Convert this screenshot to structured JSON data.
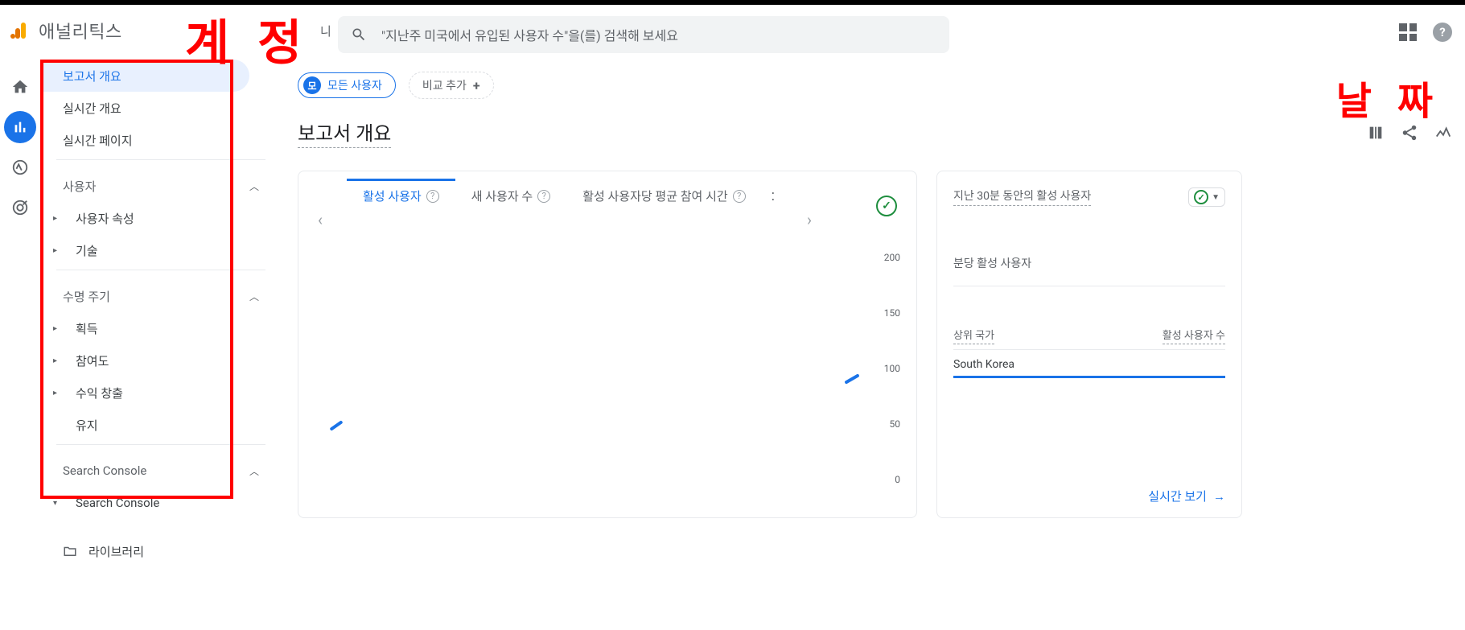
{
  "header": {
    "app_name": "애널리틱스",
    "search_placeholder": "\"지난주 미국에서 유입된 사용자 수\"을(를) 검색해 보세요",
    "fragment": "니"
  },
  "annotations": {
    "account": "계 정",
    "date": "날 짜"
  },
  "sidebar": {
    "items": [
      {
        "label": "보고서 개요",
        "selected": true
      },
      {
        "label": "실시간 개요"
      },
      {
        "label": "실시간 페이지"
      }
    ],
    "section_user": "사용자",
    "user_items": [
      {
        "label": "사용자 속성"
      },
      {
        "label": "기술"
      }
    ],
    "section_lifecycle": "수명 주기",
    "lifecycle_items": [
      {
        "label": "획득"
      },
      {
        "label": "참여도"
      },
      {
        "label": "수익 창출"
      },
      {
        "label": "유지"
      }
    ],
    "section_sc": "Search Console",
    "sc_items": [
      {
        "label": "Search Console"
      }
    ],
    "library": "라이브러리"
  },
  "comparison": {
    "all_users_badge": "모",
    "all_users": "모든 사용자",
    "add_comparison": "비교 추가"
  },
  "page_title": "보고서 개요",
  "metrics": {
    "active_users": "활성 사용자",
    "new_users": "새 사용자 수",
    "avg_engagement": "활성 사용자당 평균 참여 시간",
    "ellipsis": ":"
  },
  "chart_data": {
    "type": "line",
    "y_ticks": [
      "200",
      "150",
      "100",
      "50",
      "0"
    ],
    "ylim": [
      0,
      200
    ],
    "series": [
      {
        "name": "활성 사용자",
        "values": []
      }
    ]
  },
  "realtime_card": {
    "title": "지난 30분 동안의 활성 사용자",
    "per_minute": "분당 활성 사용자",
    "col_country": "상위 국가",
    "col_users": "활성 사용자 수",
    "row_country": "South Korea",
    "link": "실시간 보기"
  }
}
